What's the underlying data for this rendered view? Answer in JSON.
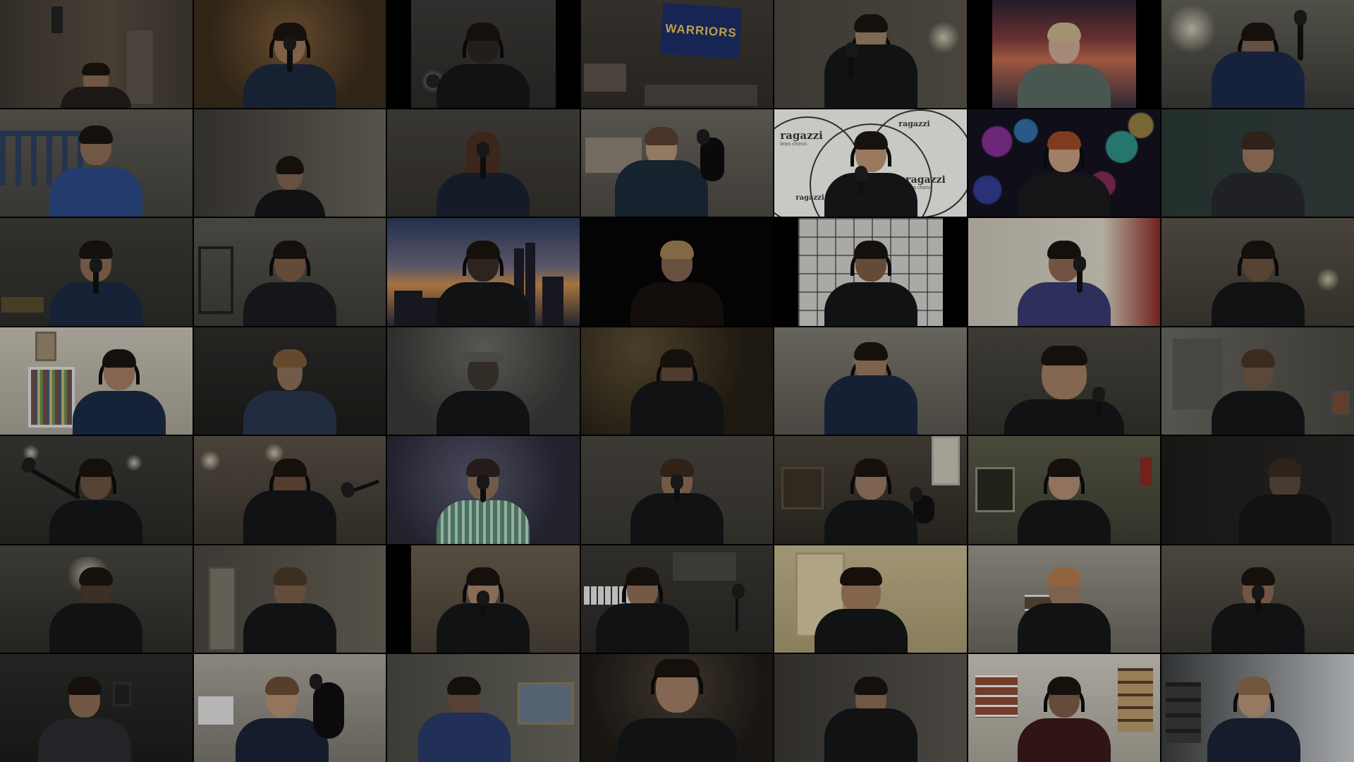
{
  "window": {
    "type": "video-conference-gallery",
    "rows": 7,
    "columns": 7,
    "tile_count": 49
  },
  "colors": {
    "background": "#000000",
    "uniform": "#141618",
    "flag_blue": "#1b2e66",
    "flag_gold": "#e6c15a"
  },
  "tiles_with_text": {
    "warriors_flag": "WARRIORS",
    "ragazzi_logo": "ragazzi",
    "ragazzi_tagline": "boys chorus"
  },
  "participants": [
    {
      "id": "r1c1",
      "scene": "bedroom-doorway"
    },
    {
      "id": "r1c2",
      "scene": "warm-room-mic"
    },
    {
      "id": "r1c3",
      "scene": "headphones-dark-room"
    },
    {
      "id": "r1c4",
      "scene": "warriors-flag-room"
    },
    {
      "id": "r1c5",
      "scene": "headphones-mic"
    },
    {
      "id": "r1c6",
      "scene": "sunset-background"
    },
    {
      "id": "r1c7",
      "scene": "mic-stand-ceiling-light"
    },
    {
      "id": "r2c1",
      "scene": "staircase-railing"
    },
    {
      "id": "r2c2",
      "scene": "dim-room"
    },
    {
      "id": "r2c3",
      "scene": "long-hair-handheld-mic"
    },
    {
      "id": "r2c4",
      "scene": "studio-mic"
    },
    {
      "id": "r2c5",
      "scene": "ragazzi-virtual-background"
    },
    {
      "id": "r2c6",
      "scene": "bokeh-background"
    },
    {
      "id": "r2c7",
      "scene": "teal-wall"
    },
    {
      "id": "r3c1",
      "scene": "handheld-mic"
    },
    {
      "id": "r3c2",
      "scene": "headphones-shelf"
    },
    {
      "id": "r3c3",
      "scene": "city-skyline-background"
    },
    {
      "id": "r3c4",
      "scene": "black-background"
    },
    {
      "id": "r3c5",
      "scene": "shoji-screen"
    },
    {
      "id": "r3c6",
      "scene": "purple-shirt-mic-stand"
    },
    {
      "id": "r3c7",
      "scene": "lamp-room"
    },
    {
      "id": "r4c1",
      "scene": "bookshelf-headphones"
    },
    {
      "id": "r4c2",
      "scene": "dark-room-glasses"
    },
    {
      "id": "r4c3",
      "scene": "cap-dark-room"
    },
    {
      "id": "r4c4",
      "scene": "dim-warm-room"
    },
    {
      "id": "r4c5",
      "scene": "headphones-lit-face"
    },
    {
      "id": "r4c6",
      "scene": "close-up-mic"
    },
    {
      "id": "r4c7",
      "scene": "poster-wall"
    },
    {
      "id": "r5c1",
      "scene": "boom-mic"
    },
    {
      "id": "r5c2",
      "scene": "mic-stand-lights"
    },
    {
      "id": "r5c3",
      "scene": "striped-shirt"
    },
    {
      "id": "r5c4",
      "scene": "plain-wall"
    },
    {
      "id": "r5c5",
      "scene": "home-studio-shelves"
    },
    {
      "id": "r5c6",
      "scene": "window-headphones"
    },
    {
      "id": "r5c7",
      "scene": "very-dark-room"
    },
    {
      "id": "r6c1",
      "scene": "ceiling-lamp"
    },
    {
      "id": "r6c2",
      "scene": "hallway"
    },
    {
      "id": "r6c3",
      "scene": "holding-mic"
    },
    {
      "id": "r6c4",
      "scene": "piano-room"
    },
    {
      "id": "r6c5",
      "scene": "yellow-door"
    },
    {
      "id": "r6c6",
      "scene": "kitchen-shelves"
    },
    {
      "id": "r6c7",
      "scene": "ceiling-room"
    },
    {
      "id": "r7c1",
      "scene": "glasses-dark-room"
    },
    {
      "id": "r7c2",
      "scene": "studio-mic-closeup"
    },
    {
      "id": "r7c3",
      "scene": "painting-wall"
    },
    {
      "id": "r7c4",
      "scene": "close-up-dark"
    },
    {
      "id": "r7c5",
      "scene": "dim-corner"
    },
    {
      "id": "r7c6",
      "scene": "shelves-headphones"
    },
    {
      "id": "r7c7",
      "scene": "window-shelves"
    }
  ]
}
